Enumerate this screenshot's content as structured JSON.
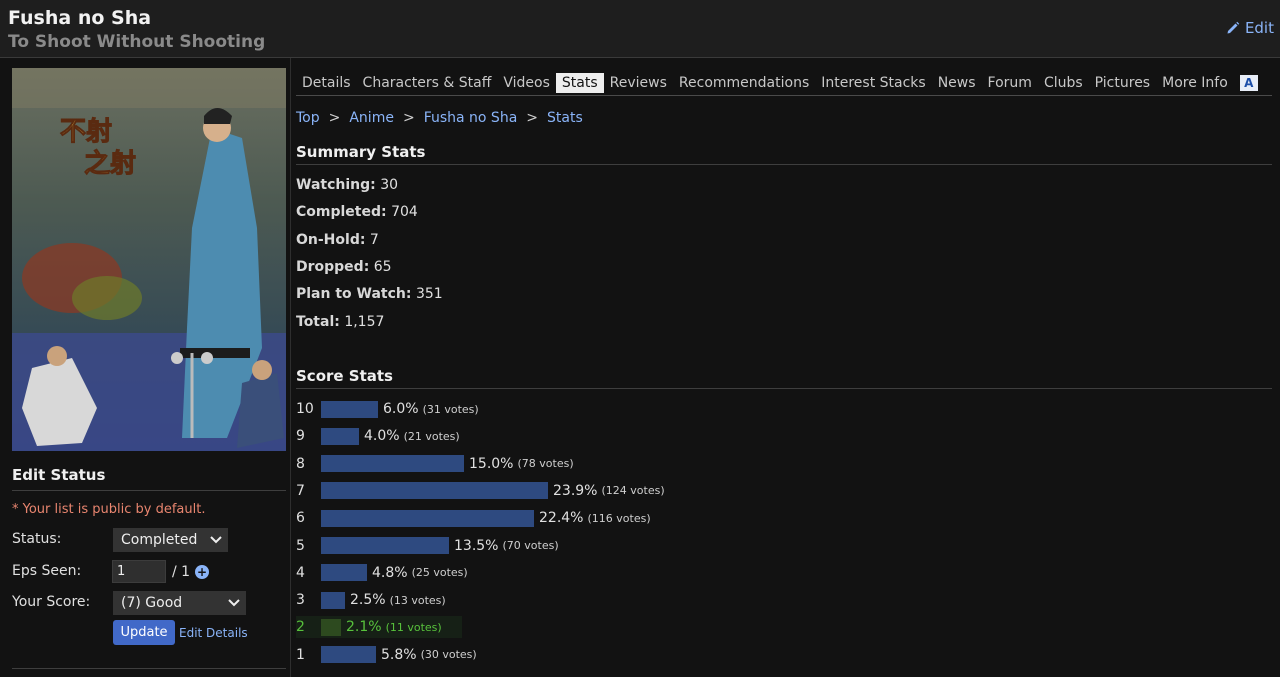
{
  "header": {
    "title": "Fusha no Sha",
    "english_title": "To Shoot Without Shooting",
    "edit_label": "Edit",
    "edit_icon": "pencil-icon"
  },
  "tabs": [
    {
      "label": "Details",
      "active": false
    },
    {
      "label": "Characters & Staff",
      "active": false
    },
    {
      "label": "Videos",
      "active": false
    },
    {
      "label": "Stats",
      "active": true
    },
    {
      "label": "Reviews",
      "active": false
    },
    {
      "label": "Recommendations",
      "active": false
    },
    {
      "label": "Interest Stacks",
      "active": false
    },
    {
      "label": "News",
      "active": false
    },
    {
      "label": "Forum",
      "active": false
    },
    {
      "label": "Clubs",
      "active": false
    },
    {
      "label": "Pictures",
      "active": false
    },
    {
      "label": "More Info",
      "active": false
    }
  ],
  "tab_logo": {
    "text": "A",
    "icon": "anime-logo-icon"
  },
  "breadcrumb": [
    "Top",
    "Anime",
    "Fusha no Sha",
    "Stats"
  ],
  "breadcrumb_sep": ">",
  "summary": {
    "heading": "Summary Stats",
    "rows": [
      {
        "label": "Watching:",
        "value": "30"
      },
      {
        "label": "Completed:",
        "value": "704"
      },
      {
        "label": "On-Hold:",
        "value": "7"
      },
      {
        "label": "Dropped:",
        "value": "65"
      },
      {
        "label": "Plan to Watch:",
        "value": "351"
      },
      {
        "label": "Total:",
        "value": "1,157"
      }
    ]
  },
  "score_stats": {
    "heading": "Score Stats",
    "rows": [
      {
        "score": "10",
        "pct": 6.0,
        "pct_label": "6.0%",
        "votes": "(31 votes)",
        "highlight": false
      },
      {
        "score": "9",
        "pct": 4.0,
        "pct_label": "4.0%",
        "votes": "(21 votes)",
        "highlight": false
      },
      {
        "score": "8",
        "pct": 15.0,
        "pct_label": "15.0%",
        "votes": "(78 votes)",
        "highlight": false
      },
      {
        "score": "7",
        "pct": 23.9,
        "pct_label": "23.9%",
        "votes": "(124 votes)",
        "highlight": false
      },
      {
        "score": "6",
        "pct": 22.4,
        "pct_label": "22.4%",
        "votes": "(116 votes)",
        "highlight": false
      },
      {
        "score": "5",
        "pct": 13.5,
        "pct_label": "13.5%",
        "votes": "(70 votes)",
        "highlight": false
      },
      {
        "score": "4",
        "pct": 4.8,
        "pct_label": "4.8%",
        "votes": "(25 votes)",
        "highlight": false
      },
      {
        "score": "3",
        "pct": 2.5,
        "pct_label": "2.5%",
        "votes": "(13 votes)",
        "highlight": false
      },
      {
        "score": "2",
        "pct": 2.1,
        "pct_label": "2.1%",
        "votes": "(11 votes)",
        "highlight": true
      },
      {
        "score": "1",
        "pct": 5.8,
        "pct_label": "5.8%",
        "votes": "(30 votes)",
        "highlight": false
      }
    ]
  },
  "cover": {
    "title_chars": [
      "不射",
      "之射"
    ]
  },
  "edit_status": {
    "heading": "Edit Status",
    "notice": "* Your list is public by default.",
    "status_label": "Status:",
    "status_value": "Completed",
    "eps_label": "Eps Seen:",
    "eps_value": "1",
    "eps_total": "/ 1",
    "score_label": "Your Score:",
    "score_value": "(7) Good",
    "update_label": "Update",
    "edit_details_label": "Edit Details"
  },
  "colors": {
    "background": "#121212",
    "link": "#8ab4f8",
    "bar": "#2e4a80",
    "highlight_text": "#58c23c",
    "notice": "#e8856f",
    "update_button": "#4169c8"
  }
}
